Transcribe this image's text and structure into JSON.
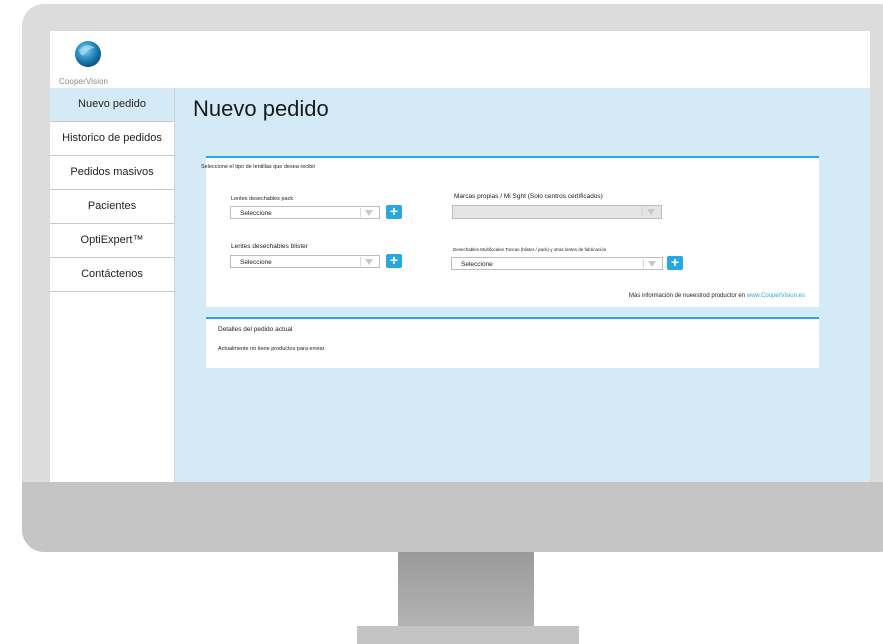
{
  "brand": {
    "logo_text": "CooperVision"
  },
  "sidebar": {
    "items": [
      {
        "label": "Nuevo pedido"
      },
      {
        "label": "Historico de pedidos"
      },
      {
        "label": "Pedidos masivos"
      },
      {
        "label": "Pacientes"
      },
      {
        "label": "OptiExpert™"
      },
      {
        "label": "Contáctenos"
      }
    ]
  },
  "main": {
    "title": "Nuevo pedido",
    "card1": {
      "heading": "Seleccione el tipo de lentillas que desea recibir",
      "pack_label": "Lentes desechables pack",
      "pack_select": "Seleccione",
      "blister_label": "Lentes desechables blister",
      "blister_select": "Seleccione",
      "own_brands_label": "Marcas propias / Mi Sght (Solo centros certificados)",
      "multifocal_label": "Desechables Multifocales Toricas (blister / pack) y otras lentes de fabricación",
      "multifocal_select": "Seleccione",
      "info_text": "Más información de nueestrod productor en",
      "info_link": "www.CooperVision.es"
    },
    "card2": {
      "heading": "Detalles del pedido actual",
      "empty_text": "Actualmente no tiene productos para enviar"
    }
  },
  "colors": {
    "accent": "#29a8e0",
    "main_bg": "#d4ebf7"
  }
}
